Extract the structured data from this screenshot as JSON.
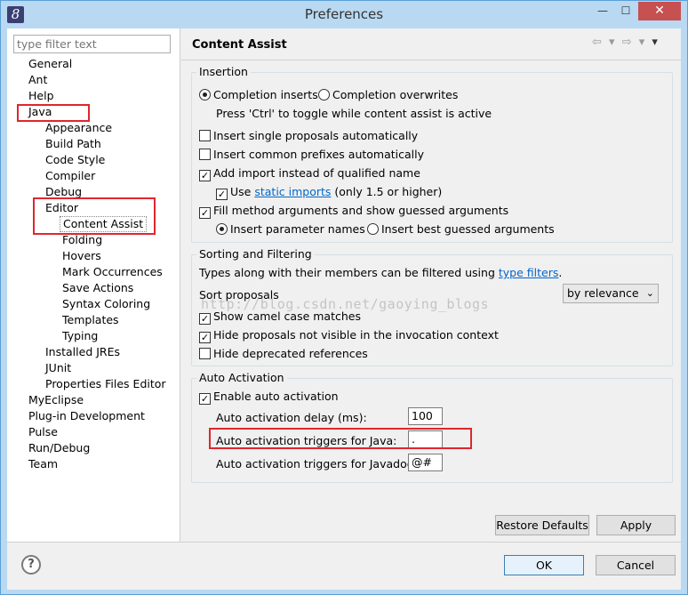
{
  "window": {
    "title": "Preferences",
    "app_icon": "8",
    "min_glyph": "—",
    "max_glyph": "☐",
    "close_glyph": "✕"
  },
  "filter": {
    "placeholder": "type filter text"
  },
  "tree": {
    "general": "General",
    "ant": "Ant",
    "help": "Help",
    "java": "Java",
    "appearance": "Appearance",
    "build_path": "Build Path",
    "code_style": "Code Style",
    "compiler": "Compiler",
    "debug": "Debug",
    "editor": "Editor",
    "content_assist": "Content Assist",
    "folding": "Folding",
    "hovers": "Hovers",
    "mark_occurrences": "Mark Occurrences",
    "save_actions": "Save Actions",
    "syntax_coloring": "Syntax Coloring",
    "templates": "Templates",
    "typing": "Typing",
    "installed_jres": "Installed JREs",
    "junit": "JUnit",
    "properties_files_editor": "Properties Files Editor",
    "myeclipse": "MyEclipse",
    "plugin_development": "Plug-in Development",
    "pulse": "Pulse",
    "run_debug": "Run/Debug",
    "team": "Team"
  },
  "page": {
    "title": "Content Assist",
    "nav_back": "⇦ ▾",
    "nav_forward": "⇨ ▾",
    "menu": "▾"
  },
  "insertion": {
    "legend": "Insertion",
    "completion_inserts": "Completion inserts",
    "completion_overwrites": "Completion overwrites",
    "toggle_hint": "Press 'Ctrl' to toggle while content assist is active",
    "insert_single": "Insert single proposals automatically",
    "insert_common": "Insert common prefixes automatically",
    "add_import": "Add import instead of qualified name",
    "use_prefix": "Use",
    "static_imports": "static imports",
    "use_suffix": "(only 1.5 or higher)",
    "fill_method": "Fill method arguments and show guessed arguments",
    "insert_param_names": "Insert parameter names",
    "insert_best_guessed": "Insert best guessed arguments",
    "check_mark": "✓"
  },
  "sorting": {
    "legend": "Sorting and Filtering",
    "types_text": "Types along with their members can be filtered using",
    "type_filters": "type filters",
    "period": ".",
    "sort_proposals": "Sort proposals",
    "sort_value": "by relevance",
    "sort_arrow": "⌄",
    "camel_case": "Show camel case matches",
    "hide_not_visible": "Hide proposals not visible in the invocation context",
    "hide_deprecated": "Hide deprecated references"
  },
  "watermark": "http://blog.csdn.net/gaoying_blogs",
  "auto_activation": {
    "legend": "Auto Activation",
    "enable": "Enable auto activation",
    "delay_label": "Auto activation delay (ms):",
    "delay_value": "100",
    "java_label": "Auto activation triggers for Java:",
    "java_value": ".",
    "javadoc_label": "Auto activation triggers for Javadoc:",
    "javadoc_value": "@#"
  },
  "buttons": {
    "restore_defaults": "Restore Defaults",
    "apply": "Apply",
    "ok": "OK",
    "cancel": "Cancel",
    "help": "?"
  },
  "colors": {
    "highlight_box": "#e0262d",
    "link": "#0066cc",
    "title_bar": "#b9d8f2",
    "close_button": "#c75050"
  }
}
